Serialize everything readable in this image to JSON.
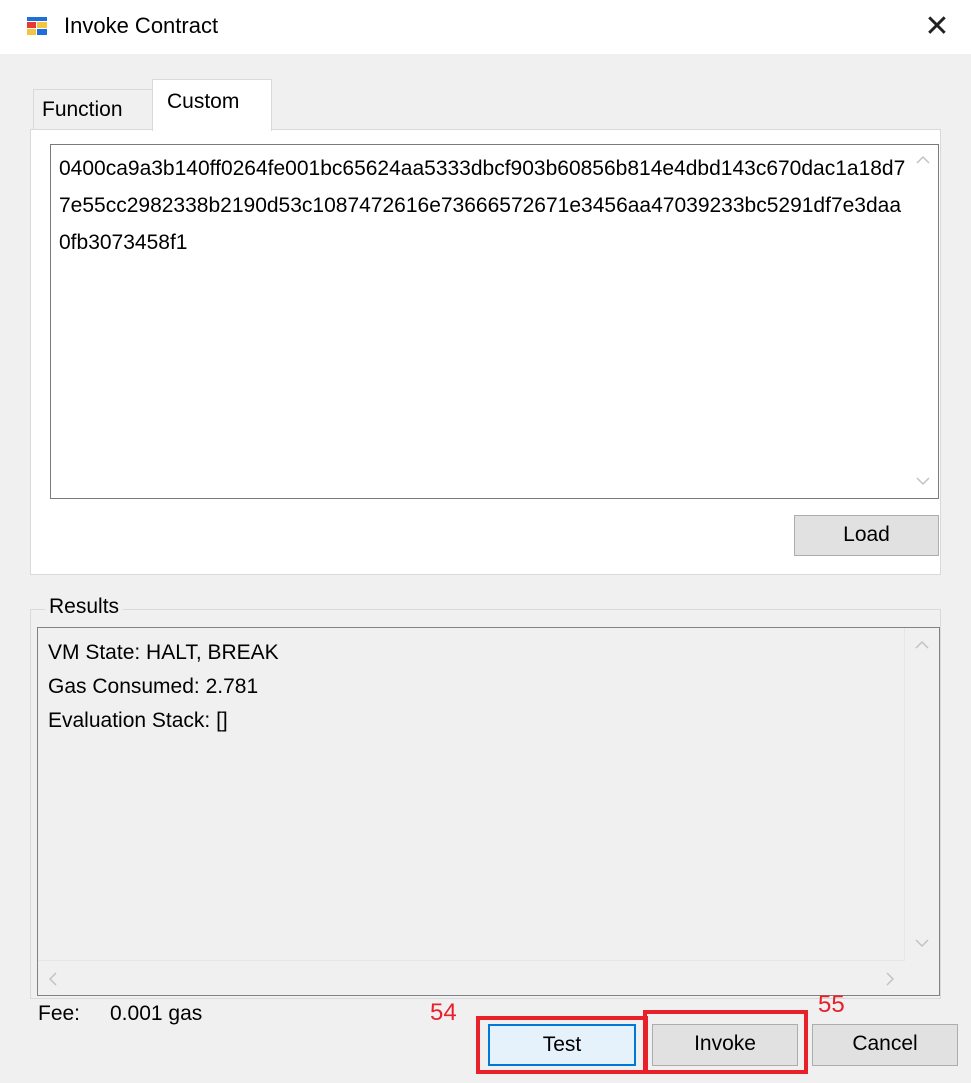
{
  "window": {
    "title": "Invoke Contract",
    "close_glyph": "✕",
    "icon": "window-app-icon"
  },
  "tabs": [
    {
      "label": "Function",
      "active": false
    },
    {
      "label": "Custom",
      "active": true
    }
  ],
  "custom": {
    "script_text": "0400ca9a3b140ff0264fe001bc65624aa5333dbcf903b60856b814e4dbd143c670dac1a18d77e55cc2982338b2190d53c1087472616e73666572671e3456aa47039233bc5291df7e3daa0fb3073458f1",
    "load_label": "Load"
  },
  "results": {
    "group_label": "Results",
    "lines": [
      "VM State: HALT, BREAK",
      "Gas Consumed: 2.781",
      "Evaluation Stack: []"
    ]
  },
  "fee": {
    "label": "Fee:",
    "value": "0.001 gas"
  },
  "buttons": {
    "test_label": "Test",
    "invoke_label": "Invoke",
    "cancel_label": "Cancel"
  },
  "annotations": {
    "test_marker": "54",
    "invoke_marker": "55",
    "color": "#e8202a"
  },
  "colors": {
    "focus_border": "#0078d7",
    "window_bg": "#f0f0f0"
  }
}
